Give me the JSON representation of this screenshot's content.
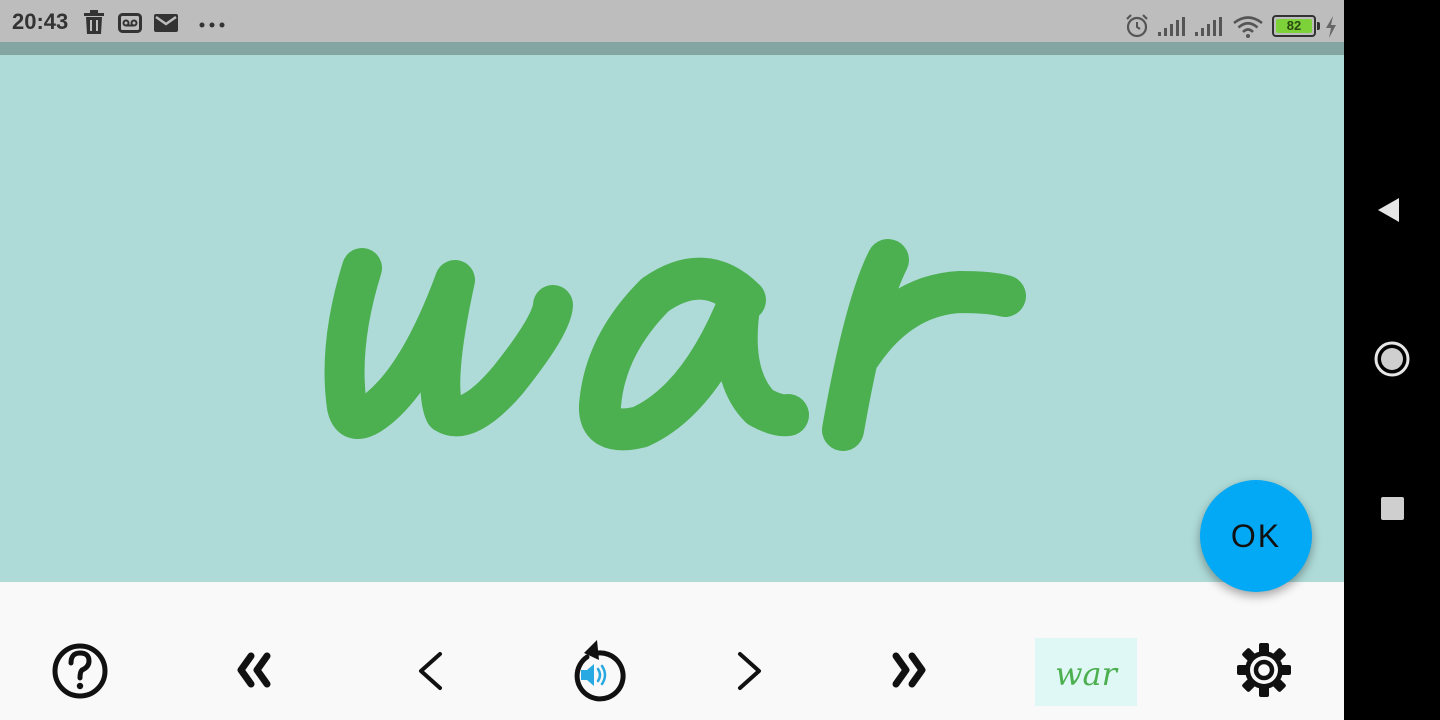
{
  "status_bar": {
    "time": "20:43",
    "left_icons": [
      "trash-icon",
      "voicemail-icon",
      "mail-icon",
      "more-dots-icon"
    ],
    "right_icons": [
      "alarm-icon",
      "signal-icon",
      "signal-icon",
      "wifi-icon",
      "battery-icon",
      "charging-icon"
    ],
    "battery_level": "82",
    "battery_color": "#7dd23a"
  },
  "word_display": {
    "word": "war",
    "background_color": "#aedbd8",
    "text_color": "#4caf50"
  },
  "ok_button": {
    "label": "OK",
    "color": "#03a9f4"
  },
  "toolbar": {
    "buttons": [
      {
        "icon": "help-icon"
      },
      {
        "icon": "double-chevron-left-icon"
      },
      {
        "icon": "chevron-left-icon"
      },
      {
        "icon": "replay-audio-icon"
      },
      {
        "icon": "chevron-right-icon"
      },
      {
        "icon": "double-chevron-right-icon"
      },
      {
        "icon": "word-thumbnail",
        "label": "war"
      },
      {
        "icon": "gear-icon"
      }
    ],
    "thumbnail_background": "#dff8f5"
  },
  "nav_bar": {
    "buttons": [
      "back-triangle-icon",
      "home-circle-icon",
      "recents-square-icon"
    ]
  }
}
